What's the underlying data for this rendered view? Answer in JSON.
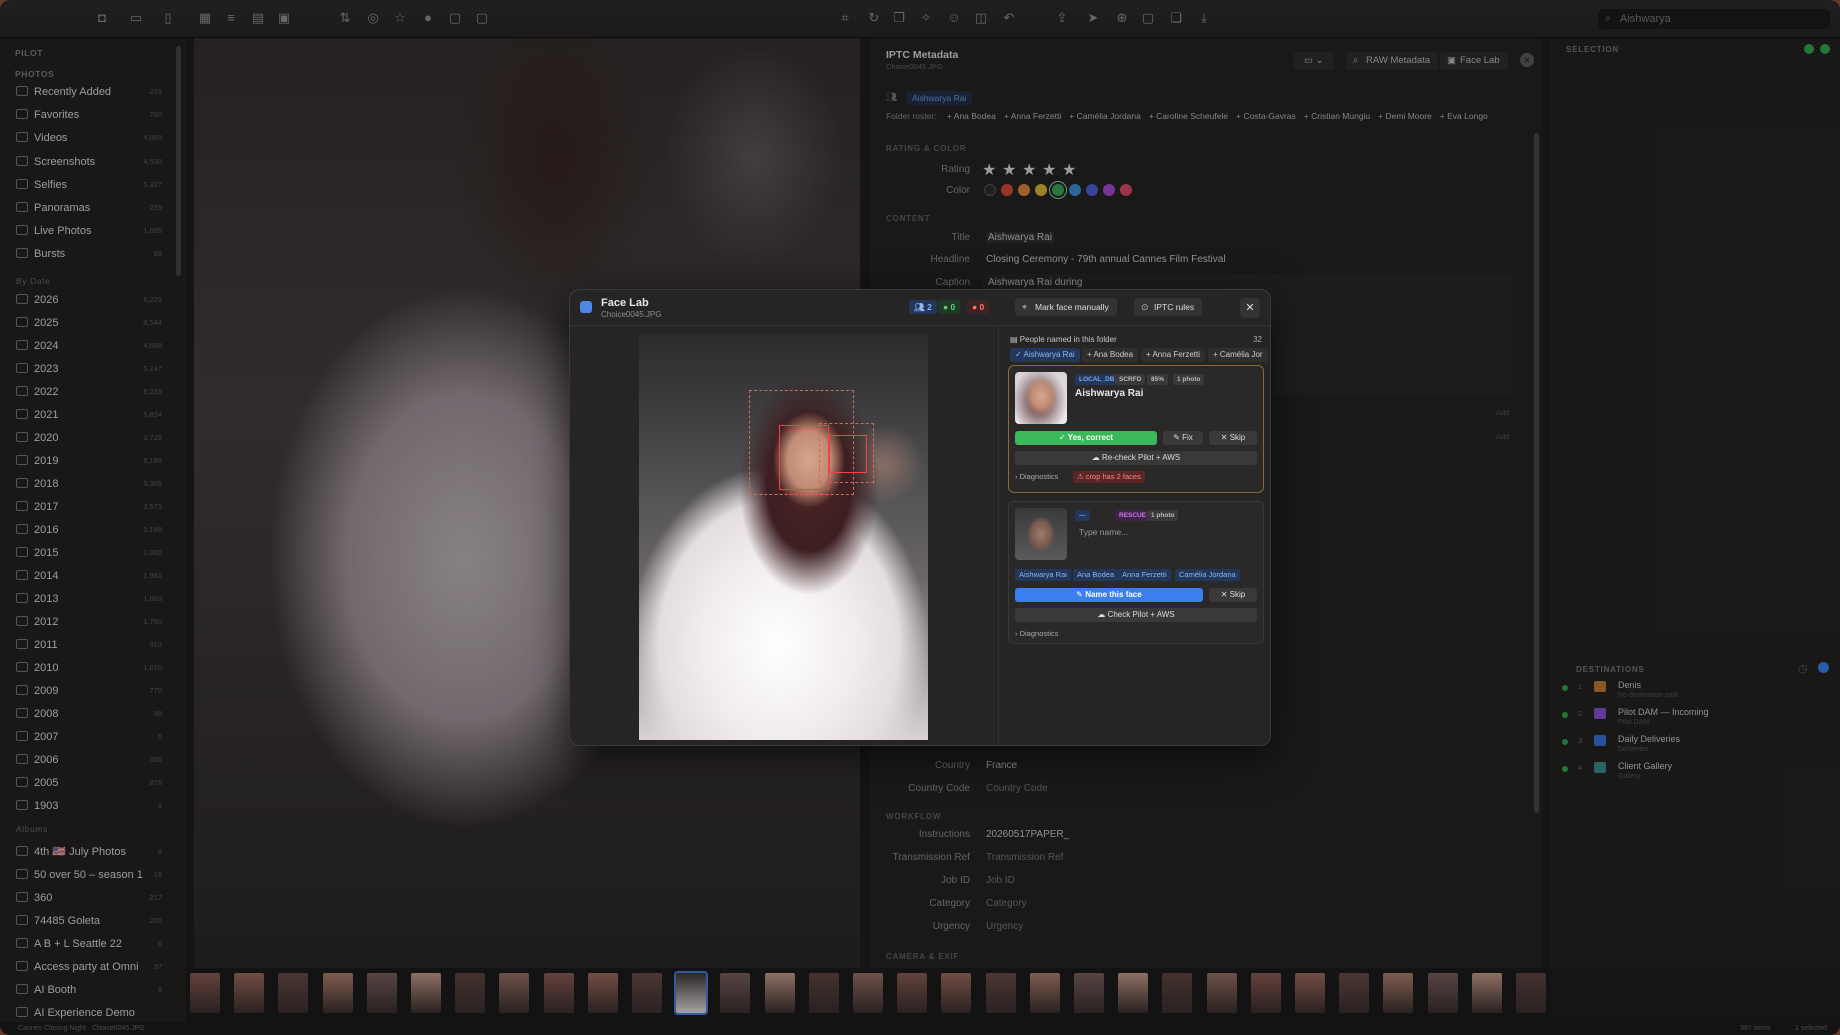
{
  "toolbar": {
    "search_value": "Aishwarya"
  },
  "sidebar": {
    "app_section": "PILOT",
    "photos_section": "PHOTOS",
    "photos": [
      {
        "label": "Recently Added",
        "count": "201"
      },
      {
        "label": "Favorites",
        "count": "780"
      },
      {
        "label": "Videos",
        "count": "4,869"
      },
      {
        "label": "Screenshots",
        "count": "4,530"
      },
      {
        "label": "Selfies",
        "count": "5,327"
      },
      {
        "label": "Panoramas",
        "count": "239"
      },
      {
        "label": "Live Photos",
        "count": "1,695"
      },
      {
        "label": "Bursts",
        "count": "89"
      }
    ],
    "by_date_section": "By Date",
    "years": [
      {
        "label": "2026",
        "count": "6,221"
      },
      {
        "label": "2025",
        "count": "8,544"
      },
      {
        "label": "2024",
        "count": "4,698"
      },
      {
        "label": "2023",
        "count": "5,247"
      },
      {
        "label": "2022",
        "count": "8,228"
      },
      {
        "label": "2021",
        "count": "5,834"
      },
      {
        "label": "2020",
        "count": "3,728"
      },
      {
        "label": "2019",
        "count": "5,189"
      },
      {
        "label": "2018",
        "count": "5,305"
      },
      {
        "label": "2017",
        "count": "3,571"
      },
      {
        "label": "2016",
        "count": "3,189"
      },
      {
        "label": "2015",
        "count": "2,002"
      },
      {
        "label": "2014",
        "count": "1,981"
      },
      {
        "label": "2013",
        "count": "1,863"
      },
      {
        "label": "2012",
        "count": "1,760"
      },
      {
        "label": "2011",
        "count": "913"
      },
      {
        "label": "2010",
        "count": "1,010"
      },
      {
        "label": "2009",
        "count": "770"
      },
      {
        "label": "2008",
        "count": "39"
      },
      {
        "label": "2007",
        "count": "5"
      },
      {
        "label": "2006",
        "count": "300"
      },
      {
        "label": "2005",
        "count": "876"
      },
      {
        "label": "1903",
        "count": "1"
      }
    ],
    "albums_section": "Albums",
    "albums": [
      {
        "label": "4th 🇺🇸 July Photos",
        "count": "8"
      },
      {
        "label": "50 over 50 – season 1",
        "count": "16"
      },
      {
        "label": "360",
        "count": "217"
      },
      {
        "label": "74485 Goleta",
        "count": "226"
      },
      {
        "label": "A B + L Seattle 22",
        "count": "6"
      },
      {
        "label": "Access party at Omni",
        "count": "37"
      },
      {
        "label": "AI Booth",
        "count": "9"
      },
      {
        "label": "AI Experience Demo",
        "count": ""
      }
    ]
  },
  "metadata": {
    "title": "IPTC Metadata",
    "filename": "Choice0045.JPG",
    "raw_button": "RAW Metadata",
    "facelab_button": "Face Lab",
    "person_tag": "Aishwarya Rai",
    "folder_roster_label": "Folder roster:",
    "folder_roster": [
      "+ Ana Bodea",
      "+ Anna Ferzetti",
      "+ Camélia Jordana",
      "+ Caroline Scheufele",
      "+ Costa-Gavras",
      "+ Cristian Mungiu",
      "+ Demi Moore",
      "+ Eva Longo"
    ],
    "rating_section": "RATING & COLOR",
    "rating_label": "Rating",
    "rating_value": 5,
    "color_label": "Color",
    "colors": [
      "#2e2e2e",
      "#d9463e",
      "#e0843a",
      "#d9b53a",
      "#3aa657",
      "#3c8fd6",
      "#4e5ed6",
      "#a24ad0",
      "#d94a6a"
    ],
    "content_section": "CONTENT",
    "title_label": "Title",
    "title_value": "Aishwarya Rai",
    "headline_label": "Headline",
    "headline_value": "Closing Ceremony - 79th annual Cannes Film Festival",
    "caption_label": "Caption",
    "caption_value": "Aishwarya Rai during",
    "country_label": "Country",
    "country_value": "France",
    "country_code_label": "Country Code",
    "country_code_value": "Country Code",
    "workflow_section": "WORKFLOW",
    "instructions_label": "Instructions",
    "instructions_value": "20260517PAPER_",
    "transmission_label": "Transmission Ref",
    "transmission_value": "Transmission Ref",
    "jobid_label": "Job ID",
    "jobid_value": "Job ID",
    "category_label": "Category",
    "category_value": "Category",
    "urgency_label": "Urgency",
    "urgency_value": "Urgency",
    "camera_section": "CAMERA & EXIF",
    "add_label": "Add"
  },
  "right_panel": {
    "selection_section": "SELECTION",
    "destinations_section": "DESTINATIONS",
    "destinations": [
      {
        "num": "1",
        "name": "Denis",
        "sub": "No destination path",
        "color": "#c07a36"
      },
      {
        "num": "2",
        "name": "Pilot DAM — Incoming",
        "sub": "Pilot DAM",
        "color": "#8a4fd6"
      },
      {
        "num": "3",
        "name": "Daily Deliveries",
        "sub": "Deliveries",
        "color": "#3c6fd6"
      },
      {
        "num": "4",
        "name": "Client Gallery",
        "sub": "Gallery",
        "color": "#3a8a8a"
      }
    ]
  },
  "statusbar": {
    "path": "Cannes Closing Night · Choice0045.JPG",
    "count": "397 items",
    "selection": "1 selected"
  },
  "facelab": {
    "title": "Face Lab",
    "filename": "Choice0045.JPG",
    "faces_count": "2",
    "ok_count": "0",
    "err_count": "0",
    "mark_button": "Mark face manually",
    "iptc_button": "IPTC rules",
    "people_header": "People named in this folder",
    "people_count": "32",
    "chips": [
      "✓ Aishwarya Rai",
      "+ Ana Bodea",
      "+ Anna Ferzetti",
      "+ Camélia Jor"
    ],
    "card1": {
      "tags": [
        "LOCAL_DB",
        "SCRFD",
        "85%",
        "1 photo"
      ],
      "name": "Aishwarya Rai",
      "yes_button": "Yes, correct",
      "fix_button": "Fix",
      "skip_button": "Skip",
      "recheck_button": "Re-check Pilot + AWS",
      "diagnostics": "Diagnostics",
      "warning": "crop has 2 faces"
    },
    "card2": {
      "tags": [
        "—",
        "RESCUE",
        "1 photo"
      ],
      "placeholder": "Type name...",
      "suggestions": [
        "Aishwarya Rai",
        "Ana Bodea",
        "Anna Ferzetti",
        "Camélia Jordana"
      ],
      "name_button": "Name this face",
      "skip_button": "Skip",
      "check_button": "Check Pilot + AWS",
      "diagnostics": "Diagnostics"
    }
  }
}
